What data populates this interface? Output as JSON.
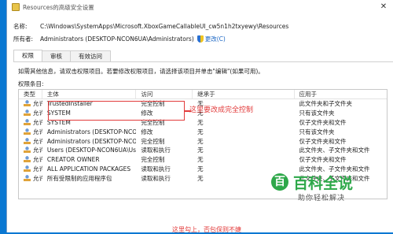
{
  "window": {
    "title": "Resources的高级安全设置",
    "close_glyph": "✕"
  },
  "header": {
    "name_label": "名称:",
    "name_value": "C:\\Windows\\SystemApps\\Microsoft.XboxGameCallableUI_cw5n1h2txyewy\\Resources",
    "owner_label": "所有者:",
    "owner_value": "Administrators (DESKTOP-NCON6UA\\Administrators)",
    "change_link": "更改(C)"
  },
  "tabs": [
    {
      "label": "权限",
      "active": true
    },
    {
      "label": "审核",
      "active": false
    },
    {
      "label": "有效访问",
      "active": false
    }
  ],
  "panel": {
    "info_text": "如需其他信息，请双击权限项目。若要修改权限项目，请选择该项目并单击\"编辑\"(如果可用)。",
    "perm_entries_label": "权限条目:"
  },
  "table": {
    "headers": [
      "类型",
      "主体",
      "访问",
      "继承于",
      "应用于"
    ],
    "rows": [
      [
        "允许",
        "TrustedInstaller",
        "完全控制",
        "无",
        "此文件夹和子文件夹"
      ],
      [
        "允许",
        "SYSTEM",
        "修改",
        "无",
        "只有该文件夹"
      ],
      [
        "允许",
        "SYSTEM",
        "完全控制",
        "无",
        "仅子文件夹和文件"
      ],
      [
        "允许",
        "Administrators (DESKTOP-NCO...",
        "修改",
        "无",
        "只有该文件夹"
      ],
      [
        "允许",
        "Administrators (DESKTOP-NCO...",
        "完全控制",
        "无",
        "仅子文件夹和文件"
      ],
      [
        "允许",
        "Users (DESKTOP-NCON6UA\\Users)",
        "读取和执行",
        "无",
        "此文件夹、子文件夹和文件"
      ],
      [
        "允许",
        "CREATOR OWNER",
        "完全控制",
        "无",
        "仅子文件夹和文件"
      ],
      [
        "允许",
        "ALL APPLICATION PACKAGES",
        "读取和执行",
        "无",
        "此文件夹、子文件夹和文件"
      ],
      [
        "允许",
        "所有受限制的应用程序包",
        "读取和执行",
        "无",
        "此文件夹、子文件夹和文件"
      ]
    ]
  },
  "annotations": {
    "top_note": "这里要改成完全控制",
    "bottom_note": "这里勾上，否包保则不婕"
  },
  "watermark": {
    "logo_glyph": "百",
    "title": "百科全说",
    "subtitle": "助你轻松解决"
  },
  "colors": {
    "accent": "#1a66c4",
    "annotation": "#e23b3b",
    "watermark": "#2ea84a",
    "desktop": "#0a78d2"
  }
}
